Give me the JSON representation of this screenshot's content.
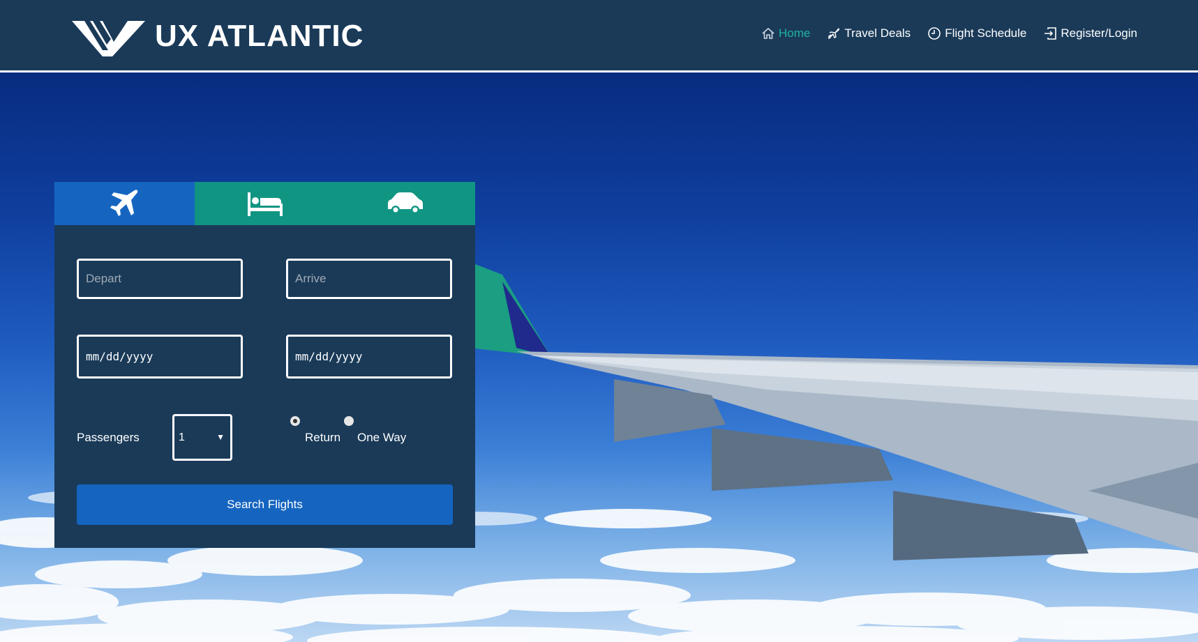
{
  "brand": {
    "name": "UX ATLANTIC"
  },
  "nav": {
    "items": [
      {
        "label": "Home",
        "icon": "home-icon",
        "active": true
      },
      {
        "label": "Travel Deals",
        "icon": "plane-icon"
      },
      {
        "label": "Flight Schedule",
        "icon": "clock-icon"
      },
      {
        "label": "Register/Login",
        "icon": "login-icon"
      }
    ]
  },
  "search": {
    "tabs": [
      {
        "name": "flights",
        "icon": "airplane-icon",
        "active": true
      },
      {
        "name": "hotels",
        "icon": "bed-icon"
      },
      {
        "name": "cars",
        "icon": "car-icon"
      }
    ],
    "depart_placeholder": "Depart",
    "arrive_placeholder": "Arrive",
    "depart_date": "mm/dd/yyyy",
    "return_date": "mm/dd/yyyy",
    "passengers_label": "Passengers",
    "passengers_value": "1",
    "return_label": "Return",
    "oneway_label": "One Way",
    "trip_type_selected": "Return",
    "button_label": "Search Flights"
  },
  "colors": {
    "header_bg": "#1a3a58",
    "nav_active": "#21b3a0",
    "tab_active": "#1565c0",
    "tab_inactive": "#119583",
    "button": "#1565c0"
  }
}
